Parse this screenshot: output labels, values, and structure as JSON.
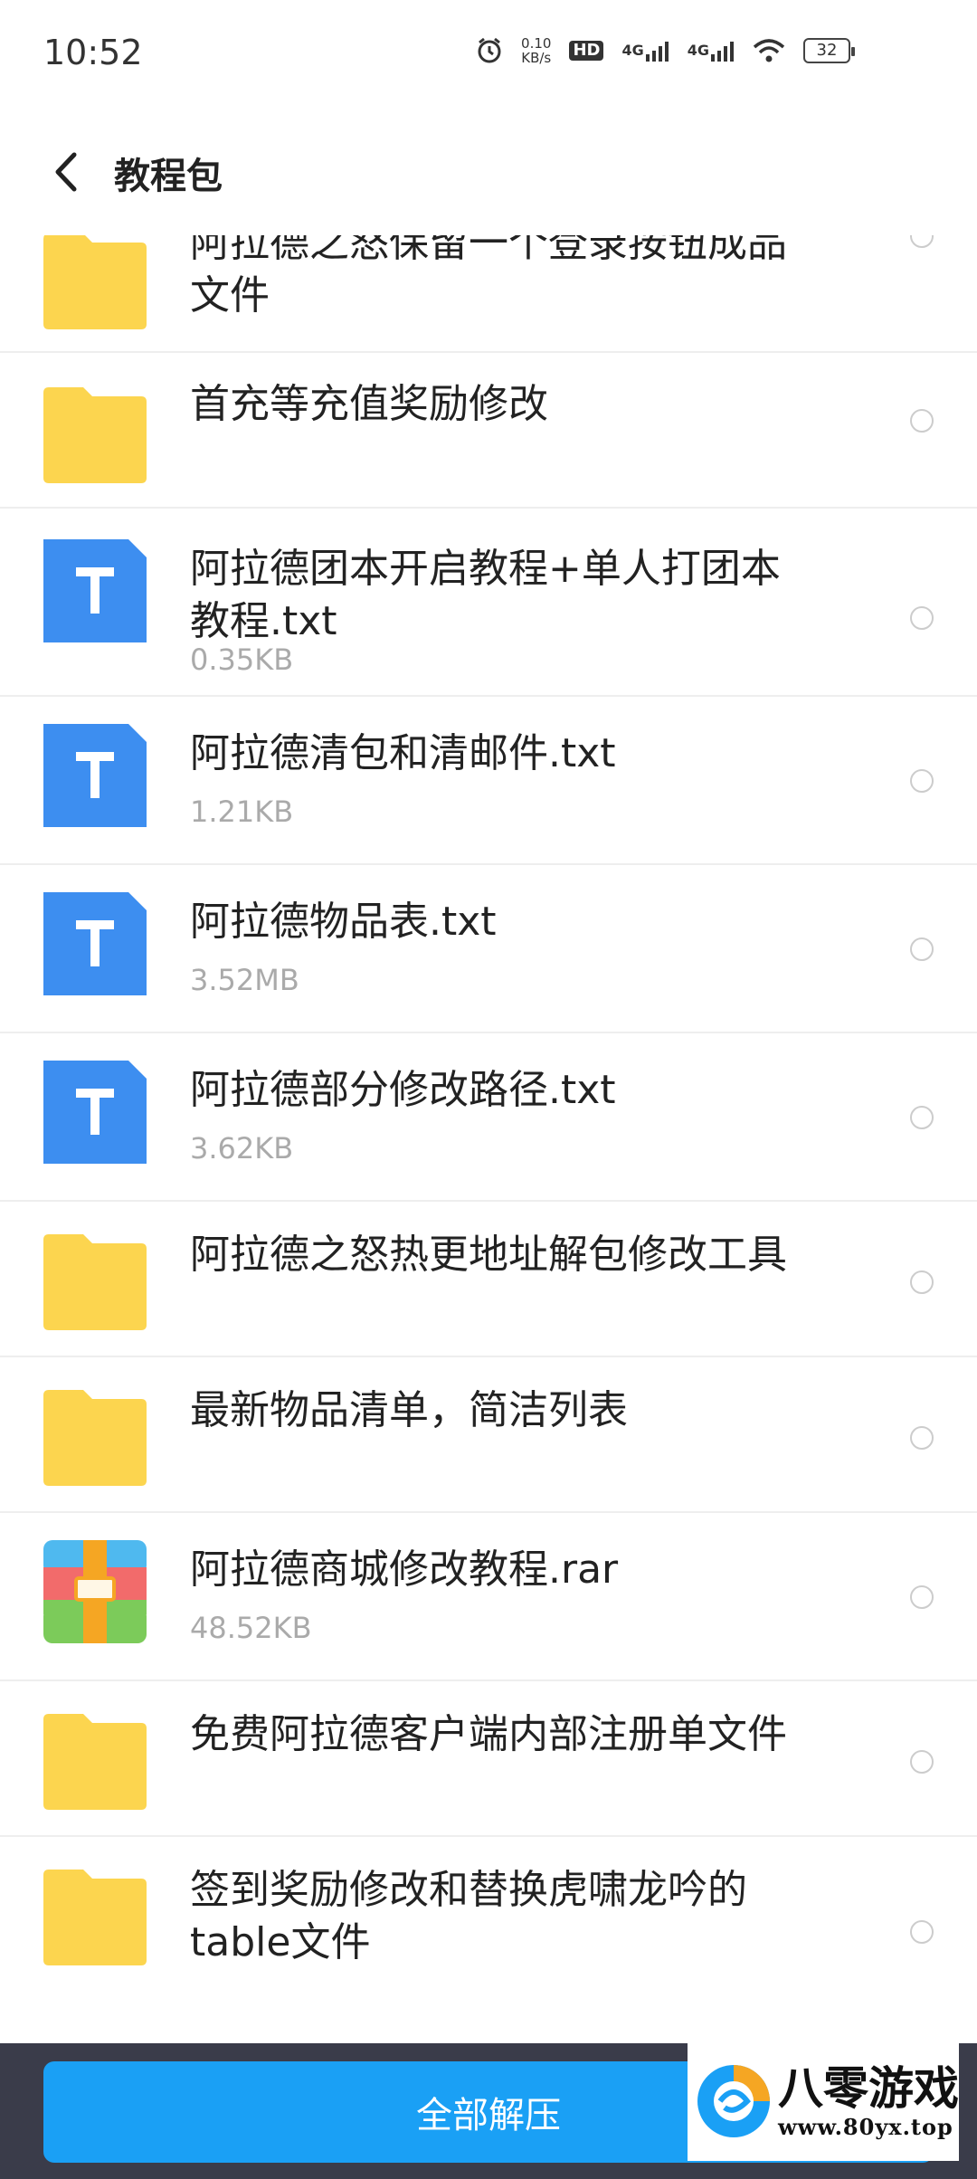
{
  "status_bar": {
    "time": "10:52",
    "net_speed_value": "0.10",
    "net_speed_unit": "KB/s",
    "hd_label": "HD",
    "signal1_label": "4G",
    "signal2_label": "4G",
    "battery": "32"
  },
  "header": {
    "title": "教程包"
  },
  "files": [
    {
      "name": "阿拉德之怒保留一个登录按钮成品文件",
      "size": "",
      "type": "folder",
      "name_line1": "阿拉德之怒保留一个登录按钮成品",
      "name_line2": "文件"
    },
    {
      "name": "首充等充值奖励修改",
      "size": "",
      "type": "folder"
    },
    {
      "name": "阿拉德团本开启教程+单人打团本教程.txt",
      "size": "0.35KB",
      "type": "txt",
      "name_line1": "阿拉德团本开启教程+单人打团本",
      "name_line2": "教程.txt"
    },
    {
      "name": "阿拉德清包和清邮件.txt",
      "size": "1.21KB",
      "type": "txt"
    },
    {
      "name": "阿拉德物品表.txt",
      "size": "3.52MB",
      "type": "txt"
    },
    {
      "name": "阿拉德部分修改路径.txt",
      "size": "3.62KB",
      "type": "txt"
    },
    {
      "name": "阿拉德之怒热更地址解包修改工具",
      "size": "",
      "type": "folder"
    },
    {
      "name": "最新物品清单，简洁列表",
      "size": "",
      "type": "folder"
    },
    {
      "name": "阿拉德商城修改教程.rar",
      "size": "48.52KB",
      "type": "rar"
    },
    {
      "name": "免费阿拉德客户端内部注册单文件",
      "size": "",
      "type": "folder"
    },
    {
      "name": "签到奖励修改和替换虎啸龙吟的table文件",
      "size": "",
      "type": "folder",
      "name_line1": "签到奖励修改和替换虎啸龙吟的",
      "name_line2": "table文件"
    }
  ],
  "bottom": {
    "extract_all_label": "全部解压"
  },
  "watermark": {
    "name": "八零游戏",
    "url": "www.80yx.top"
  },
  "colors": {
    "accent": "#1aa0f5",
    "folder": "#fcd54f",
    "txt_icon": "#3d8ef0",
    "bottom_bar": "#3a3c4a"
  }
}
